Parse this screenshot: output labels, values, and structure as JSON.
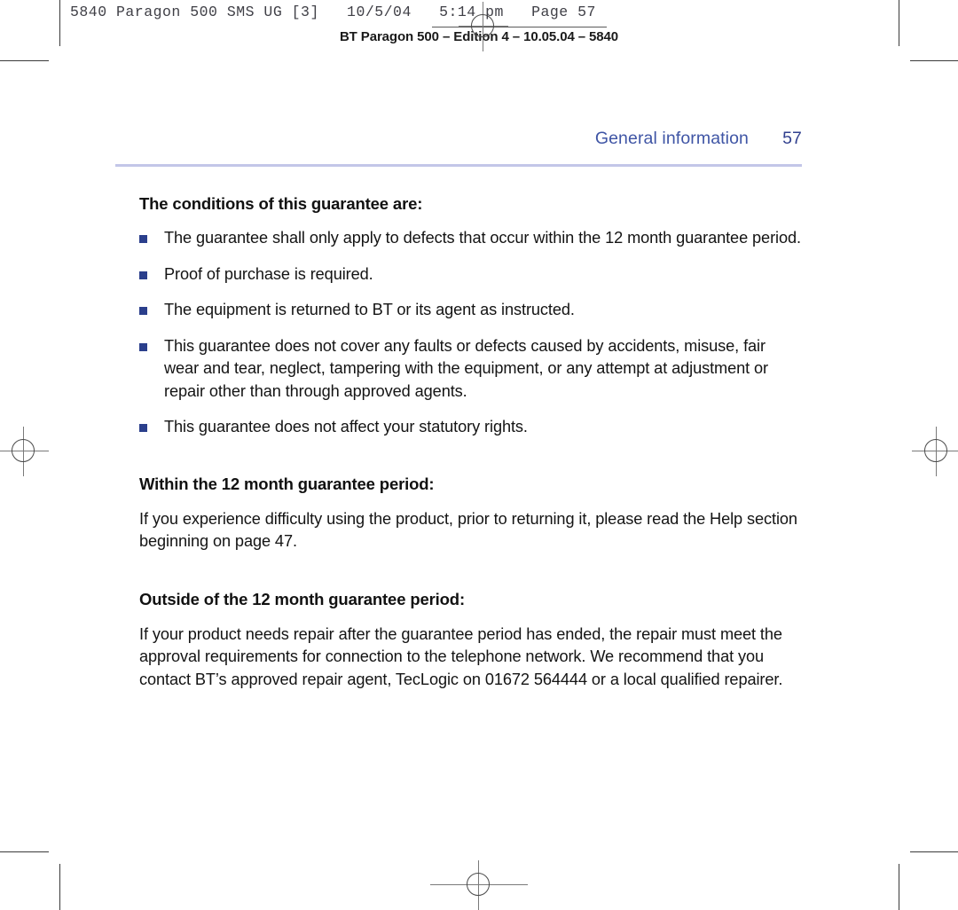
{
  "slug": {
    "job_line": "5840 Paragon 500 SMS UG [3]   10/5/04   5:14 pm   Page 57",
    "subtitle": "BT Paragon 500 – Edition 4 – 10.05.04 – 5840"
  },
  "running_head": {
    "title": "General information",
    "page_number": "57"
  },
  "colors": {
    "accent_blue": "#3f55a5",
    "rule_lavender": "#c3c6e8",
    "bullet_navy": "#2b3f8c",
    "body_text": "#141414"
  },
  "sections": [
    {
      "heading": "The conditions of this guarantee are:",
      "bullets": [
        "The guarantee shall only apply to defects that occur within the 12 month guarantee period.",
        "Proof of purchase is required.",
        "The equipment is returned to BT or its agent as instructed.",
        "This guarantee does not cover any faults or defects caused by accidents, misuse, fair wear and tear, neglect, tampering with the equipment, or any attempt at adjustment or repair other than through approved agents.",
        "This guarantee does not affect your statutory rights."
      ]
    },
    {
      "heading": "Within the 12 month guarantee period:",
      "paragraph": "If you experience difficulty using the product, prior to returning it, please read the Help section beginning on page 47."
    },
    {
      "heading": "Outside of the 12 month guarantee period:",
      "paragraph": "If your product needs repair after the guarantee period has ended, the repair must meet the approval requirements for connection to the telephone network. We recommend that you contact BT’s approved repair agent, TecLogic on 01672 564444 or a local qualified repairer."
    }
  ]
}
